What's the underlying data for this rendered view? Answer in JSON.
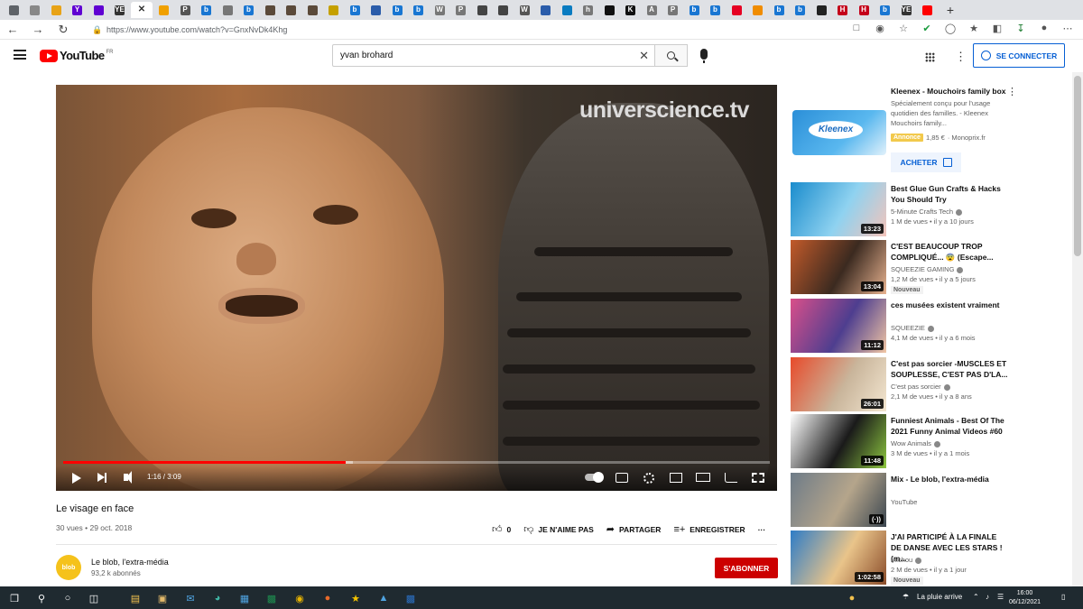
{
  "browser": {
    "url": "https://www.youtube.com/watch?v=GnxNvDk4Khg",
    "tabs": [
      {
        "label": "",
        "color": "#5f6368"
      },
      {
        "label": "",
        "color": "#888"
      },
      {
        "label": "",
        "color": "#e8a317"
      },
      {
        "label": "Y",
        "color": "#6001d2"
      },
      {
        "label": "",
        "color": "#6001d2"
      },
      {
        "label": "YE",
        "color": "#333"
      },
      {
        "label": "✕",
        "color": "#fff",
        "active": true
      },
      {
        "label": "",
        "color": "#f0a000"
      },
      {
        "label": "P",
        "color": "#555"
      },
      {
        "label": "b",
        "color": "#1976d2"
      },
      {
        "label": "",
        "color": "#777"
      },
      {
        "label": "b",
        "color": "#1976d2"
      },
      {
        "label": "",
        "color": "#5b4a3a"
      },
      {
        "label": "",
        "color": "#5b4a3a"
      },
      {
        "label": "",
        "color": "#5b4a3a"
      },
      {
        "label": "",
        "color": "#c5a000"
      },
      {
        "label": "b",
        "color": "#1976d2"
      },
      {
        "label": "",
        "color": "#2a5caa"
      },
      {
        "label": "b",
        "color": "#1976d2"
      },
      {
        "label": "b",
        "color": "#1976d2"
      },
      {
        "label": "W",
        "color": "#777"
      },
      {
        "label": "P",
        "color": "#777"
      },
      {
        "label": "",
        "color": "#444"
      },
      {
        "label": "",
        "color": "#444"
      },
      {
        "label": "W",
        "color": "#555"
      },
      {
        "label": "",
        "color": "#2a5caa"
      },
      {
        "label": "",
        "color": "#0a7cc1"
      },
      {
        "label": "h",
        "color": "#777"
      },
      {
        "label": "",
        "color": "#111"
      },
      {
        "label": "K",
        "color": "#111"
      },
      {
        "label": "A",
        "color": "#777"
      },
      {
        "label": "P",
        "color": "#777"
      },
      {
        "label": "b",
        "color": "#1976d2"
      },
      {
        "label": "b",
        "color": "#1976d2"
      },
      {
        "label": "",
        "color": "#e60023"
      },
      {
        "label": "",
        "color": "#f08c00"
      },
      {
        "label": "b",
        "color": "#1976d2"
      },
      {
        "label": "b",
        "color": "#1976d2"
      },
      {
        "label": "",
        "color": "#222"
      },
      {
        "label": "H",
        "color": "#c4001a"
      },
      {
        "label": "H",
        "color": "#c4001a"
      },
      {
        "label": "b",
        "color": "#1976d2"
      },
      {
        "label": "YE",
        "color": "#333"
      },
      {
        "label": "",
        "color": "#ff0000"
      }
    ],
    "new_tab": "+"
  },
  "youtube": {
    "logo_text": "YouTube",
    "logo_region": "FR",
    "search_value": "yvan brohard",
    "sign_in": "SE CONNECTER"
  },
  "player": {
    "watermark": "universcience.tv",
    "time": "1:16 / 3:09",
    "progress_fraction": 0.4,
    "buffered_fraction": 0.41
  },
  "video": {
    "title": "Le visage en face",
    "meta": "30 vues • 29 oct. 2018",
    "likes": "0",
    "dislike": "JE N'AIME PAS",
    "share": "PARTAGER",
    "save": "ENREGISTRER",
    "more": "···"
  },
  "channel": {
    "avatar_text": "blob",
    "name": "Le blob, l'extra-média",
    "subs": "93,2 k abonnés",
    "subscribe": "S'ABONNER"
  },
  "ad": {
    "title": "Kleenex - Mouchoirs family box",
    "desc": "Spécialement conçu pour l'usage quotidien des familles. - Kleenex Mouchoirs family...",
    "badge": "Annonce",
    "price": "1,85 €",
    "store": "· Monoprix.fr",
    "logo": "Kleenex",
    "cta": "ACHETER"
  },
  "recommendations": [
    {
      "title": "Best Glue Gun Crafts & Hacks You Should Try",
      "channel": "5-Minute Crafts Tech",
      "meta": "1 M de vues • il y a 10 jours",
      "duration": "13:23",
      "verified": true,
      "thumb": [
        "#1a8ccd",
        "#8fd2f0",
        "#f4c4ba"
      ]
    },
    {
      "title": "C'EST BEAUCOUP TROP COMPLIQUÉ... 😨 (Escape...",
      "channel": "SQUEEZIE GAMING",
      "meta": "1,2 M de vues • il y a 5 jours",
      "duration": "13:04",
      "verified": true,
      "badge": "Nouveau",
      "thumb": [
        "#c25a2a",
        "#3b2a20",
        "#e7b28f"
      ]
    },
    {
      "title": "ces musées existent vraiment",
      "channel": "SQUEEZIE",
      "meta": "4,1 M de vues • il y a 6 mois",
      "duration": "11:12",
      "verified": true,
      "thumb": [
        "#d94f8a",
        "#4e3e8f",
        "#f1c6a4"
      ]
    },
    {
      "title": "C'est pas sorcier -MUSCLES ET SOUPLESSE, C'EST PAS D'LA...",
      "channel": "C'est pas sorcier",
      "meta": "2,1 M de vues • il y a 8 ans",
      "duration": "26:01",
      "verified": true,
      "thumb": [
        "#e84a2a",
        "#c9b59b",
        "#f3e6d0"
      ]
    },
    {
      "title": "Funniest Animals - Best Of The 2021 Funny Animal Videos #60",
      "channel": "Wow Animals",
      "meta": "3 M de vues • il y a 1 mois",
      "duration": "11:48",
      "verified": true,
      "thumb": [
        "#ffffff",
        "#1a1a1a",
        "#8cc63f"
      ]
    },
    {
      "title": "Mix - Le blob, l'extra-média",
      "channel": "YouTube",
      "meta": "",
      "duration": "(·))",
      "verified": false,
      "thumb": [
        "#6d7b88",
        "#b5a58b",
        "#3b4650"
      ]
    },
    {
      "title": "J'AI PARTICIPÉ À LA FINALE DE DANSE AVEC LES STARS ! (m...",
      "channel": "Michou",
      "meta": "2 M de vues • il y a 1 jour",
      "duration": "1:02:58",
      "verified": true,
      "badge": "Nouveau",
      "thumb": [
        "#2e7cc7",
        "#e9c48a",
        "#8a4c2a"
      ]
    }
  ],
  "taskbar": {
    "weather": "La pluie arrive",
    "time": "16:00",
    "date": "06/12/2021"
  }
}
